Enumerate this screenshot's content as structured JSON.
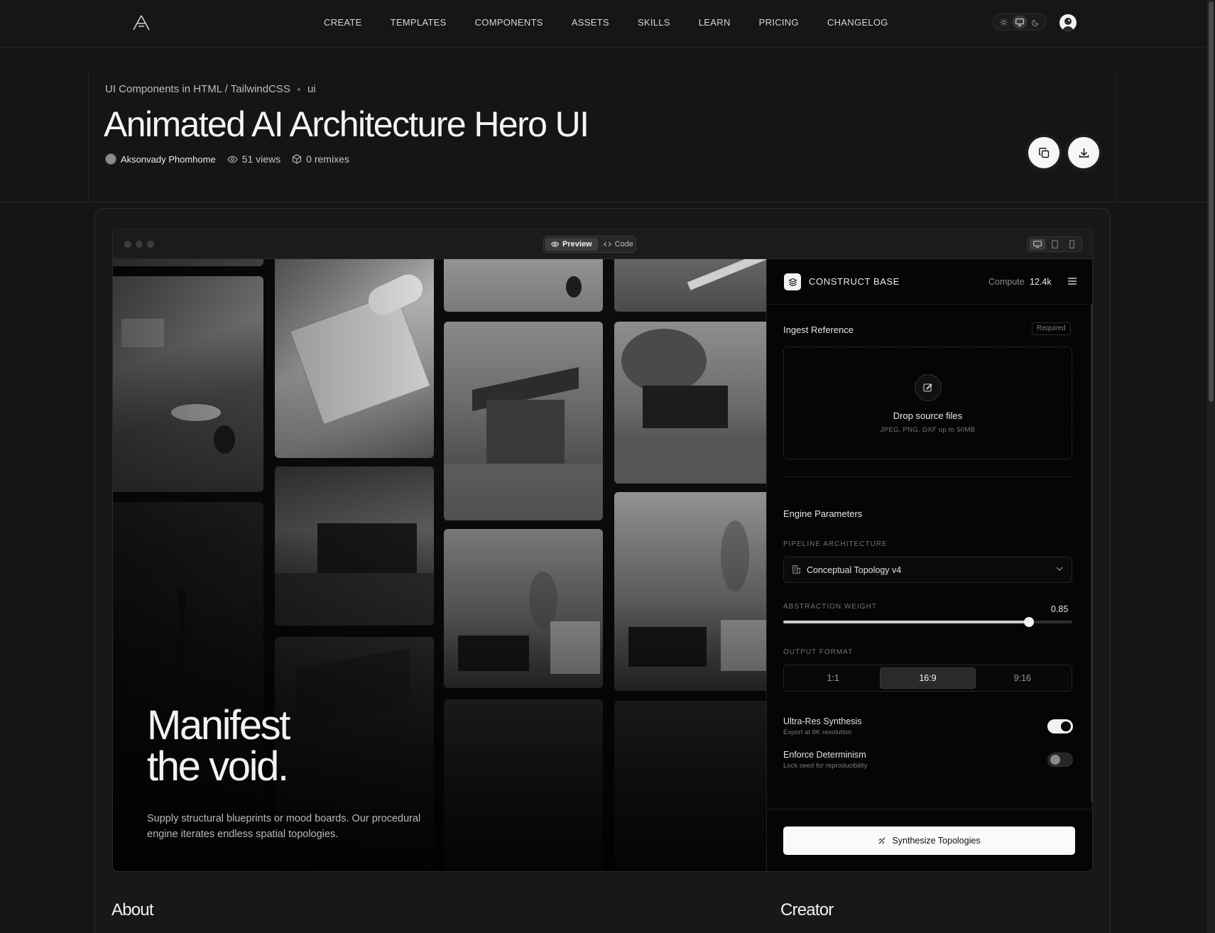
{
  "nav": {
    "links": [
      "CREATE",
      "TEMPLATES",
      "COMPONENTS",
      "ASSETS",
      "SKILLS",
      "LEARN",
      "PRICING",
      "CHANGELOG"
    ],
    "theme_options": [
      "sun-icon",
      "monitor-icon",
      "moon-icon"
    ],
    "theme_active": "monitor-icon"
  },
  "header": {
    "breadcrumb_parent": "UI Components in HTML / TailwindCSS",
    "breadcrumb_tag": "ui",
    "title": "Animated AI Architecture Hero UI",
    "author": "Aksonvady Phomhome",
    "views": "51 views",
    "remixes": "0 remixes"
  },
  "preview_bar": {
    "preview_label": "Preview",
    "code_label": "Code",
    "active": "Preview",
    "devices": [
      "desktop-icon",
      "tablet-icon",
      "mobile-icon"
    ]
  },
  "hero": {
    "title_line1": "Manifest",
    "title_line2": "the void.",
    "subtitle": "Supply structural blueprints or mood boards. Our procedural engine iterates endless spatial topologies."
  },
  "panel": {
    "title": "CONSTRUCT BASE",
    "compute_label": "Compute",
    "compute_value": "12.4k",
    "ingest_title": "Ingest Reference",
    "required": "Required",
    "drop_title": "Drop source files",
    "drop_sub": "JPEG, PNG, DXF up to 50MB",
    "engine_title": "Engine Parameters",
    "pipeline_label": "PIPELINE ARCHITECTURE",
    "pipeline_value": "Conceptual Topology v4",
    "abstraction_label": "ABSTRACTION WEIGHT",
    "abstraction_value": "0.85",
    "abstraction_fraction": 0.85,
    "output_label": "OUTPUT FORMAT",
    "output_options": [
      "1:1",
      "16:9",
      "9:16"
    ],
    "output_active": "16:9",
    "toggle1_label": "Ultra-Res Synthesis",
    "toggle1_sub": "Export at 8K resolution",
    "toggle1_on": true,
    "toggle2_label": "Enforce Determinism",
    "toggle2_sub": "Lock seed for reproducibility",
    "toggle2_on": false,
    "cta": "Synthesize Topologies"
  },
  "bottom": {
    "about": "About",
    "creator": "Creator"
  }
}
